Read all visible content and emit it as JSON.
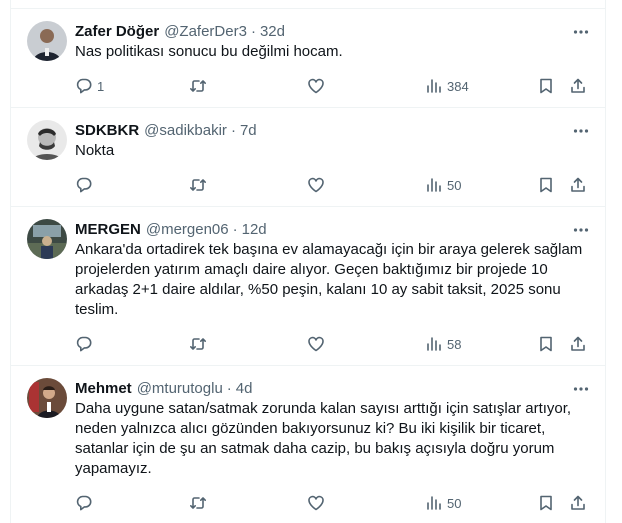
{
  "tweets": [
    {
      "name": "Zafer Döğer",
      "handle": "@ZaferDer3",
      "time": "32d",
      "text": "Nas politikası sonucu bu değilmi hocam.",
      "replies": "1",
      "views": "384"
    },
    {
      "name": "SDKBKR",
      "handle": "@sadikbakir",
      "time": "7d",
      "text": "Nokta",
      "replies": "",
      "views": "50"
    },
    {
      "name": "MERGEN",
      "handle": "@mergen06",
      "time": "12d",
      "text": "Ankara'da ortadirek tek başına ev alamayacağı için bir araya gelerek sağlam projelerden yatırım amaçlı daire alıyor. Geçen baktığımız bir projede 10 arkadaş 2+1 daire aldılar, %50 peşin, kalanı 10 ay sabit taksit, 2025 sonu teslim.",
      "replies": "",
      "views": "58"
    },
    {
      "name": "Mehmet",
      "handle": "@mturutoglu",
      "time": "4d",
      "text": "Daha uygune satan/satmak zorunda kalan sayısı arttığı için satışlar artıyor, neden yalnızca alıcı gözünden bakıyorsunuz ki? Bu iki kişilik bir ticaret, satanlar için de şu an satmak daha cazip, bu bakış açısıyla doğru yorum yapamayız.",
      "replies": "",
      "views": "50"
    }
  ],
  "icons": {
    "more": "more-horizontal-icon",
    "reply": "reply-icon",
    "retweet": "retweet-icon",
    "like": "heart-icon",
    "views": "views-bar-chart-icon",
    "bookmark": "bookmark-icon",
    "share": "share-icon"
  },
  "colors": {
    "text_primary": "#0f1419",
    "text_secondary": "#536471",
    "divider": "#eff3f4"
  }
}
